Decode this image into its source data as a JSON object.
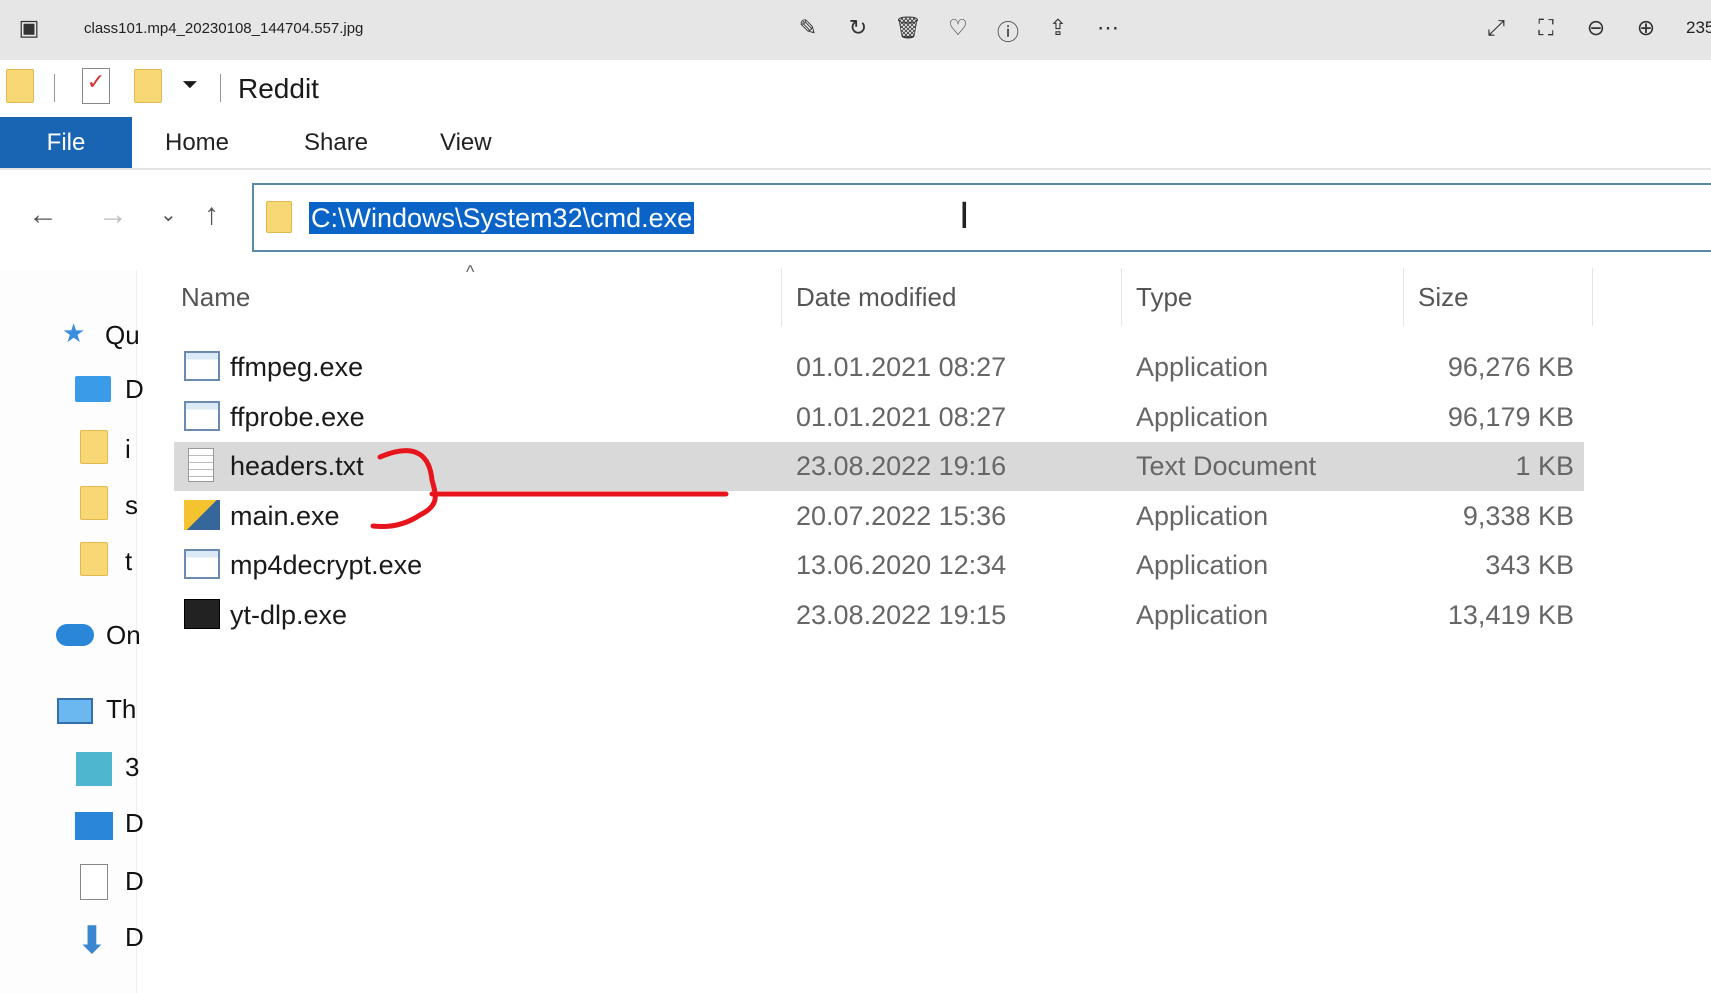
{
  "viewer": {
    "title": "class101.mp4_20230108_144704.557.jpg",
    "zoom": "235",
    "icons": [
      "edit-icon",
      "rotate-icon",
      "delete-icon",
      "favorite-icon",
      "info-icon",
      "share-icon",
      "more-icon",
      "expand-icon",
      "fit-icon",
      "zoom-out-icon",
      "zoom-in-icon"
    ]
  },
  "explorer": {
    "window_title": "Reddit",
    "ribbon": {
      "file": "File",
      "tabs": [
        "Home",
        "Share",
        "View"
      ]
    },
    "address": "C:\\Windows\\System32\\cmd.exe",
    "sidebar": [
      "Qu",
      "D",
      "i",
      "s",
      "t",
      "On",
      "Th",
      "3",
      "D",
      "D",
      "D"
    ],
    "columns": {
      "name": "Name",
      "date": "Date modified",
      "type": "Type",
      "size": "Size"
    },
    "files": [
      {
        "name": "ffmpeg.exe",
        "date": "01.01.2021 08:27",
        "type": "Application",
        "size": "96,276 KB",
        "icon": "exe-icon"
      },
      {
        "name": "ffprobe.exe",
        "date": "01.01.2021 08:27",
        "type": "Application",
        "size": "96,179 KB",
        "icon": "exe-icon"
      },
      {
        "name": "headers.txt",
        "date": "23.08.2022 19:16",
        "type": "Text Document",
        "size": "1 KB",
        "icon": "text-file-icon",
        "selected": true
      },
      {
        "name": "main.exe",
        "date": "20.07.2022 15:36",
        "type": "Application",
        "size": "9,338 KB",
        "icon": "python-exe-icon"
      },
      {
        "name": "mp4decrypt.exe",
        "date": "13.06.2020 12:34",
        "type": "Application",
        "size": "343 KB",
        "icon": "exe-icon"
      },
      {
        "name": "yt-dlp.exe",
        "date": "23.08.2022 19:15",
        "type": "Application",
        "size": "13,419 KB",
        "icon": "yt-dlp-icon"
      }
    ]
  },
  "annotation_color": "#e8141c"
}
